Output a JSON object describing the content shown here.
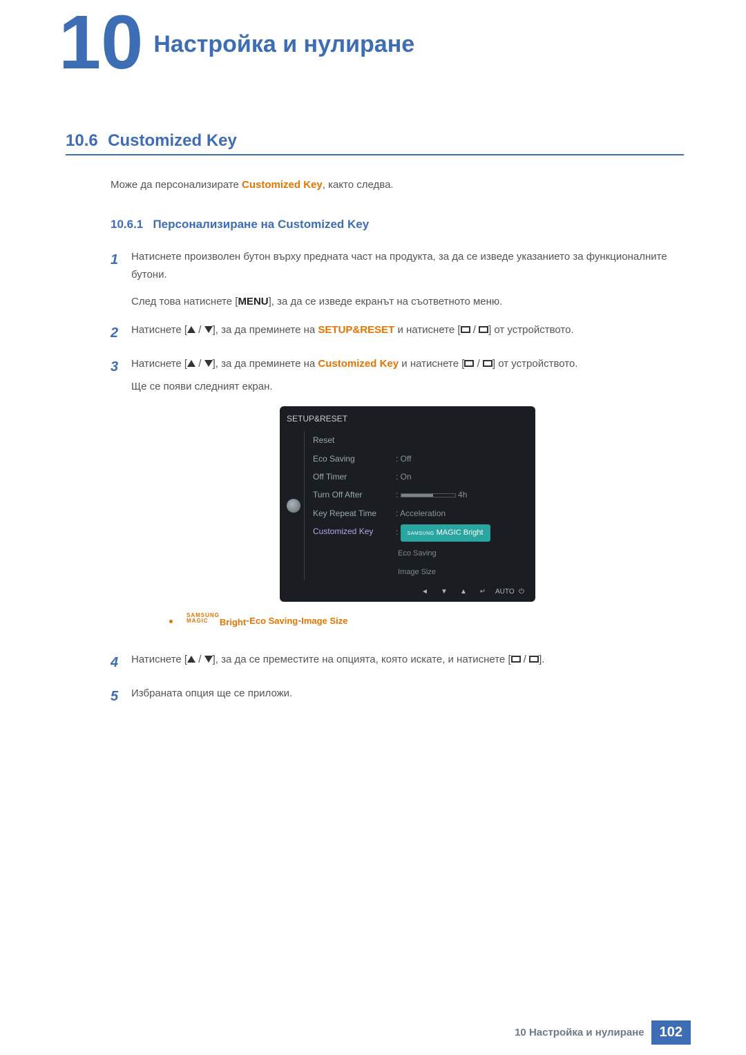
{
  "header": {
    "chapter_number": "10",
    "chapter_title": "Настройка и нулиране"
  },
  "section": {
    "number": "10.6",
    "title": "Customized Key"
  },
  "intro": {
    "pre": "Може да персонализирате ",
    "highlight": "Customized Key",
    "post": ", както следва."
  },
  "subsection": {
    "number": "10.6.1",
    "title": "Персонализиране на Customized Key"
  },
  "steps": {
    "s1": "Натиснете произволен бутон върху предната част на продукта, за да се изведе указанието за функционалните бутони.",
    "s1b": {
      "pre": "След това натиснете [",
      "btn": "MENU",
      "post": "], за да се изведе екранът на съответното меню."
    },
    "s2": {
      "pre": "Натиснете [",
      "mid1": "], за да преминете на ",
      "kw1": "SETUP&RESET",
      "mid2": " и натиснете [",
      "post": "] от устройството."
    },
    "s3": {
      "pre": "Натиснете [",
      "mid1": "], за да преминете на ",
      "kw1": "Customized Key",
      "mid2": " и натиснете [",
      "post": "] от устройството."
    },
    "s3b": "Ще се появи следният екран.",
    "s4": {
      "pre": "Натиснете [",
      "mid1": "], за да се преместите на опцията, която искате, и натиснете [",
      "post": "]."
    },
    "s5": "Избраната опция ще се приложи."
  },
  "osd": {
    "title": "SETUP&RESET",
    "rows": {
      "r0": {
        "lbl": "Reset",
        "val": ""
      },
      "r1": {
        "lbl": "Eco Saving",
        "val": "Off"
      },
      "r2": {
        "lbl": "Off Timer",
        "val": "On"
      },
      "r3": {
        "lbl": "Turn Off After",
        "val": "4h"
      },
      "r4": {
        "lbl": "Key Repeat Time",
        "val": "Acceleration"
      },
      "r5": {
        "lbl": "Customized Key",
        "val": "MAGIC Bright",
        "prefix": "SAMSUNG"
      },
      "dd1": "Eco Saving",
      "dd2": "Image Size"
    },
    "nav": {
      "n1": "◄",
      "n2": "▼",
      "n3": "▲",
      "n4": "↵",
      "n5": "AUTO",
      "n6": "⏻"
    }
  },
  "bullet": {
    "magic": "Bright",
    "magic_prefix": "SAMSUNG",
    "magic_sub": "MAGIC",
    "sep": " - ",
    "eco": "Eco Saving",
    "size": "Image Size"
  },
  "footer": {
    "text": "10 Настройка и нулиране",
    "page": "102"
  }
}
